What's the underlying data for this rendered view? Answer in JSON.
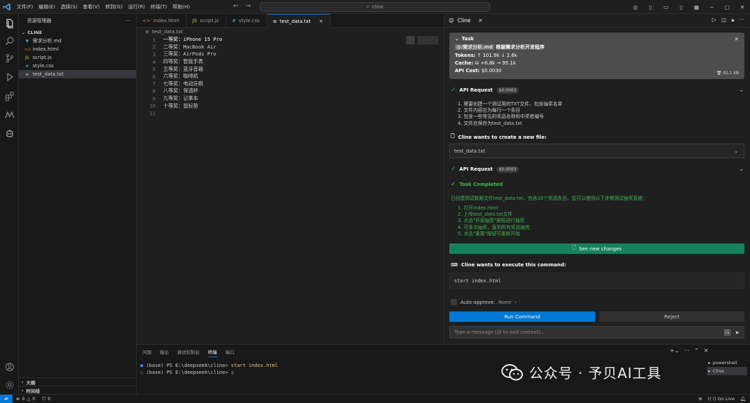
{
  "titlebar": {
    "menu": [
      "文件(F)",
      "编辑(E)",
      "选择(S)",
      "查看(V)",
      "转到(G)",
      "运行(R)",
      "终端(T)",
      "帮助(H)"
    ],
    "search_text": "cline"
  },
  "explorer": {
    "title": "资源管理器",
    "root": "CLINE",
    "files": [
      {
        "icon": "markdown-icon",
        "glyph": "▼",
        "name": "需求分析.md"
      },
      {
        "icon": "html-icon",
        "glyph": "<>",
        "name": "index.html"
      },
      {
        "icon": "js-icon",
        "glyph": "JS",
        "name": "script.js"
      },
      {
        "icon": "css-icon",
        "glyph": "#",
        "name": "style.css"
      },
      {
        "icon": "text-file-icon",
        "glyph": "≡",
        "name": "test_data.txt",
        "selected": true
      }
    ],
    "outline_label": "大纲",
    "timeline_label": "时间线"
  },
  "editor": {
    "tabs": [
      {
        "icon": "html-icon",
        "glyph": "<>",
        "name": "index.html",
        "color": "#e37933"
      },
      {
        "icon": "js-icon",
        "glyph": "JS",
        "name": "script.js",
        "color": "#cbcb41"
      },
      {
        "icon": "css-icon",
        "glyph": "#",
        "name": "style.css",
        "color": "#519aba"
      },
      {
        "icon": "text-file-icon",
        "glyph": "≡",
        "name": "test_data.txt",
        "color": "#cccccc",
        "active": true
      }
    ],
    "breadcrumb": "test_data.txt",
    "lines": [
      {
        "n": "1",
        "t": "一等奖：iPhone 15 Pro"
      },
      {
        "n": "2",
        "t": "二等奖：MacBook Air"
      },
      {
        "n": "3",
        "t": "三等奖：AirPods Pro"
      },
      {
        "n": "4",
        "t": "四等奖：智能手表"
      },
      {
        "n": "5",
        "t": "五等奖：蓝牙音箱"
      },
      {
        "n": "6",
        "t": "六等奖：咖啡机"
      },
      {
        "n": "7",
        "t": "七等奖：电动牙刷"
      },
      {
        "n": "8",
        "t": "八等奖：保温杯"
      },
      {
        "n": "9",
        "t": "九等奖：记事本"
      },
      {
        "n": "10",
        "t": "十等奖：鼠标垫"
      },
      {
        "n": "11",
        "t": ""
      }
    ]
  },
  "cline": {
    "panel_title": "Cline",
    "task": {
      "label": "Task",
      "mention": "@/需求分析.md",
      "text": " 根据需求分析开发程序",
      "tokens_label": "Tokens:",
      "tokens_value": "↑ 101.9k ↓ 2.6k",
      "cache_label": "Cache:",
      "cache_value": "⛁ +6.8k → 95.1k",
      "cost_label": "API Cost:",
      "cost_value": "$0.0030",
      "size": "91.1 kB"
    },
    "api_request_1": {
      "label": "API Request",
      "cost": "$0.0003"
    },
    "thinking_items": [
      "1. 需要创建一个测试用的TXT文件，包含抽奖名单",
      "2. 文件内容应为每行一个条目",
      "3. 包含一些常见的奖品名称和中奖者编号",
      "4. 文件应保存为test_data.txt"
    ],
    "create_file_label": "Cline wants to create a new file:",
    "create_file_name": "test_data.txt",
    "api_request_2": {
      "label": "API Request",
      "cost": "$0.0003"
    },
    "task_completed_label": "Task Completed",
    "completion_text": "已创建测试数据文件test_data.txt，包含10个奖品条目。您可以使用以下步骤测试抽奖系统：",
    "completion_steps": [
      "1. 打开index.html",
      "2. 上传test_data.txt文件",
      "3. 点击\"开始抽奖\"按钮进行抽奖",
      "4. 可多次抽奖，直到所有奖品抽完",
      "5. 点击\"重置\"按钮可重新开始"
    ],
    "see_changes_label": "See new changes",
    "execute_label": "Cline wants to execute this command:",
    "command": "start index.html",
    "auto_approve_label": "Auto-approve:",
    "auto_approve_value": "None",
    "run_label": "Run Command",
    "reject_label": "Reject",
    "message_placeholder": "Type a message (@ to add context)..."
  },
  "panel": {
    "tabs": [
      "问题",
      "输出",
      "调试控制台",
      "终端",
      "端口"
    ],
    "active_tab": "终端",
    "terminal_lines": [
      {
        "prompt": "(base) PS E:\\deepseek\\cline> ",
        "cmd": "start index.html"
      },
      {
        "prompt": "(base) PS E:\\deepseek\\cline> ",
        "cmd": ""
      }
    ],
    "terminals": [
      "powershell",
      "Cline"
    ]
  },
  "watermark": "公众号 · 予贝AI工具",
  "status": {
    "errors": "0",
    "warnings": "0",
    "ports": "0",
    "golive": "Go Live"
  },
  "colors": {
    "accent": "#0078d4",
    "success": "#3fb950",
    "see_changes_bg": "#16825d"
  }
}
